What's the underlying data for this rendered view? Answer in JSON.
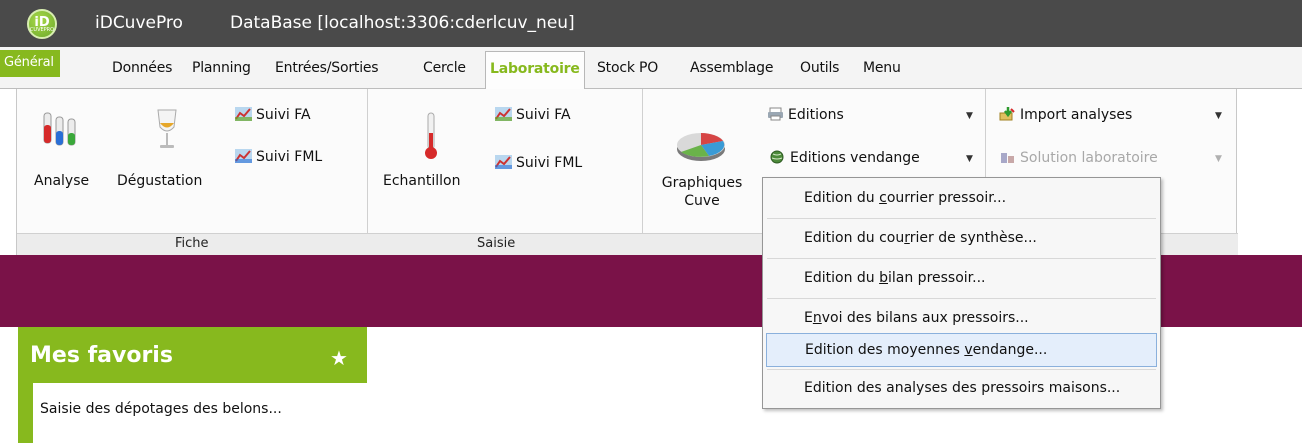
{
  "window": {
    "logo_text": "iD",
    "logo_sub": "CUVEPRO",
    "app_name": "iDCuvePro",
    "database": "DataBase [localhost:3306:cderlcuv_neu]"
  },
  "menu": {
    "general": "Général",
    "donnees": "Données",
    "planning": "Planning",
    "entrees": "Entrées/Sorties",
    "cercle": "Cercle",
    "laboratoire": "Laboratoire",
    "stockpo": "Stock PO",
    "assemblage": "Assemblage",
    "outils": "Outils",
    "menu": "Menu"
  },
  "ribbon": {
    "fiche": {
      "label": "Fiche",
      "analyse": "Analyse",
      "degustation": "Dégustation",
      "suivi_fa": "Suivi FA",
      "suivi_fml": "Suivi FML"
    },
    "saisie": {
      "label": "Saisie",
      "echantillon": "Echantillon",
      "suivi_fa": "Suivi FA",
      "suivi_fml": "Suivi FML"
    },
    "editions_group": {
      "graphiques_line1": "Graphiques",
      "graphiques_line2": "Cuve",
      "editions": "Editions",
      "editions_vendange": "Editions vendange"
    },
    "import_group": {
      "import_analyses": "Import analyses",
      "solution_laboratoire": "Solution laboratoire"
    }
  },
  "dropdown": {
    "items": [
      {
        "before": "Edition du ",
        "mnemonic": "c",
        "after": "ourrier pressoir..."
      },
      {
        "before": "Edition du cou",
        "mnemonic": "r",
        "after": "rier de synthèse..."
      },
      {
        "before": "Edition du ",
        "mnemonic": "b",
        "after": "ilan pressoir..."
      },
      {
        "before": "E",
        "mnemonic": "n",
        "after": "voi des bilans aux pressoirs..."
      },
      {
        "before": "Edition des moyennes ",
        "mnemonic": "v",
        "after": "endange..."
      },
      {
        "before": "Edition des analyses des pressoirs maisons...",
        "mnemonic": "",
        "after": ""
      }
    ]
  },
  "favorites": {
    "title": "Mes favoris",
    "items": [
      "Saisie des dépotages des belons..."
    ]
  },
  "colors": {
    "accent_green": "#87b91e",
    "banner_purple": "#7a1248",
    "titlebar": "#4a4a4a"
  }
}
